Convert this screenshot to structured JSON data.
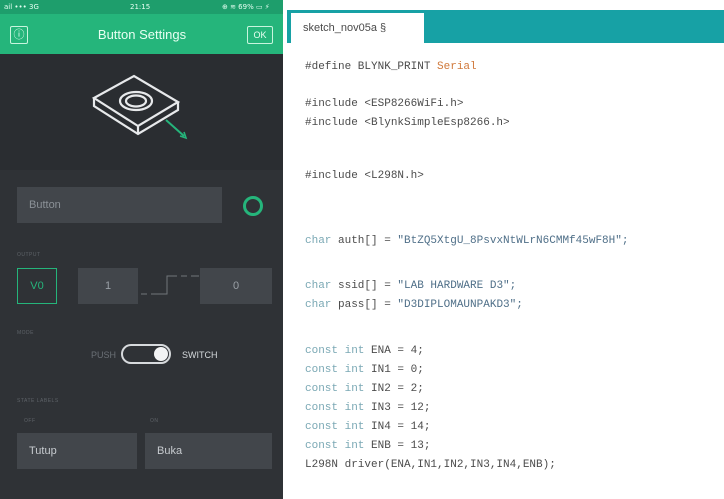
{
  "phone": {
    "status": {
      "left": "ail ••• 3G",
      "time": "21:15",
      "right": "⊕ ≋ 69% ▭ ⚡"
    },
    "app_bar": {
      "title": "Button Settings",
      "ok_label": "OK"
    },
    "name_placeholder": "Button",
    "sections": {
      "output": "OUTPUT",
      "mode": "MODE",
      "state_labels": "STATE LABELS",
      "off": "OFF",
      "on": "ON"
    },
    "output": {
      "pin": "V0",
      "low": "1",
      "high": "0"
    },
    "mode": {
      "push": "PUSH",
      "switch": "SWITCH",
      "selected": "SWITCH"
    },
    "state_labels": {
      "off": "Tutup",
      "on": "Buka"
    },
    "colors": {
      "accent": "#25b57b",
      "background": "#2f3236",
      "field": "#42464b"
    }
  },
  "editor": {
    "tab_label": "sketch_nov05a §",
    "code": {
      "define": "#define BLYNK_PRINT ",
      "define_arg": "Serial",
      "inc1": "#include <ESP8266WiFi.h>",
      "inc2": "#include <BlynkSimpleEsp8266.h>",
      "inc3": "#include <L298N.h>",
      "auth_decl": " auth[] = ",
      "auth_val": "\"BtZQ5XtgU_8PsvxNtWLrN6CMMf45wF8H\";",
      "ssid_decl": " ssid[] = ",
      "ssid_val": "\"LAB HARDWARE D3\";",
      "pass_decl": " pass[] = ",
      "pass_val": "\"D3DIPLOMAUNPAKD3\";",
      "char_kw": "char",
      "const_kw": "const int",
      "ena": " ENA = 4;",
      "in1": " IN1 = 0;",
      "in2": " IN2 = 2;",
      "in3": " IN3 = 12;",
      "in4": " IN4 = 14;",
      "enb": " ENB = 13;",
      "driver": "L298N driver(ENA,IN1,IN2,IN3,IN4,ENB);"
    },
    "colors": {
      "tab_bar": "#17a1a5",
      "keyword": "#7aa8b4",
      "highlight": "#d0783a"
    }
  }
}
